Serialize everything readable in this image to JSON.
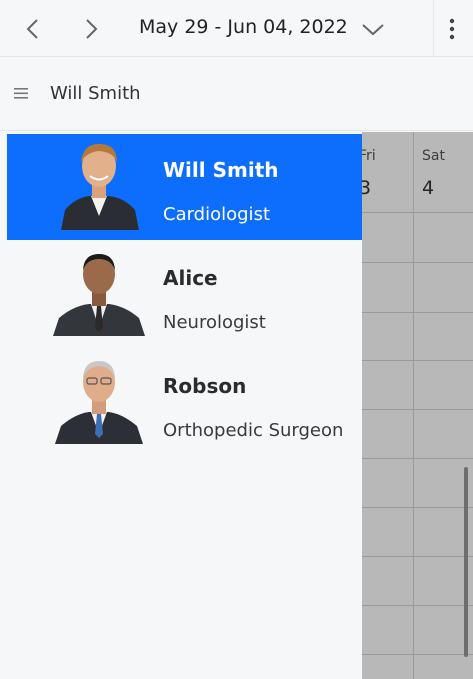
{
  "header": {
    "date_range": "May 29 - Jun 04, 2022"
  },
  "subheader": {
    "selected_resource": "Will Smith"
  },
  "calendar": {
    "days": [
      {
        "name": "Fri",
        "num": "3"
      },
      {
        "name": "Sat",
        "num": "4"
      }
    ]
  },
  "resources": [
    {
      "name": "Will Smith",
      "role": "Cardiologist",
      "selected": true
    },
    {
      "name": "Alice",
      "role": "Neurologist",
      "selected": false
    },
    {
      "name": "Robson",
      "role": "Orthopedic Surgeon",
      "selected": false
    }
  ],
  "colors": {
    "accent": "#0d6efd",
    "background": "#f6f7f9"
  },
  "icons": [
    "chevron-left-icon",
    "chevron-right-icon",
    "chevron-down-icon",
    "more-vertical-icon",
    "menu-icon"
  ]
}
